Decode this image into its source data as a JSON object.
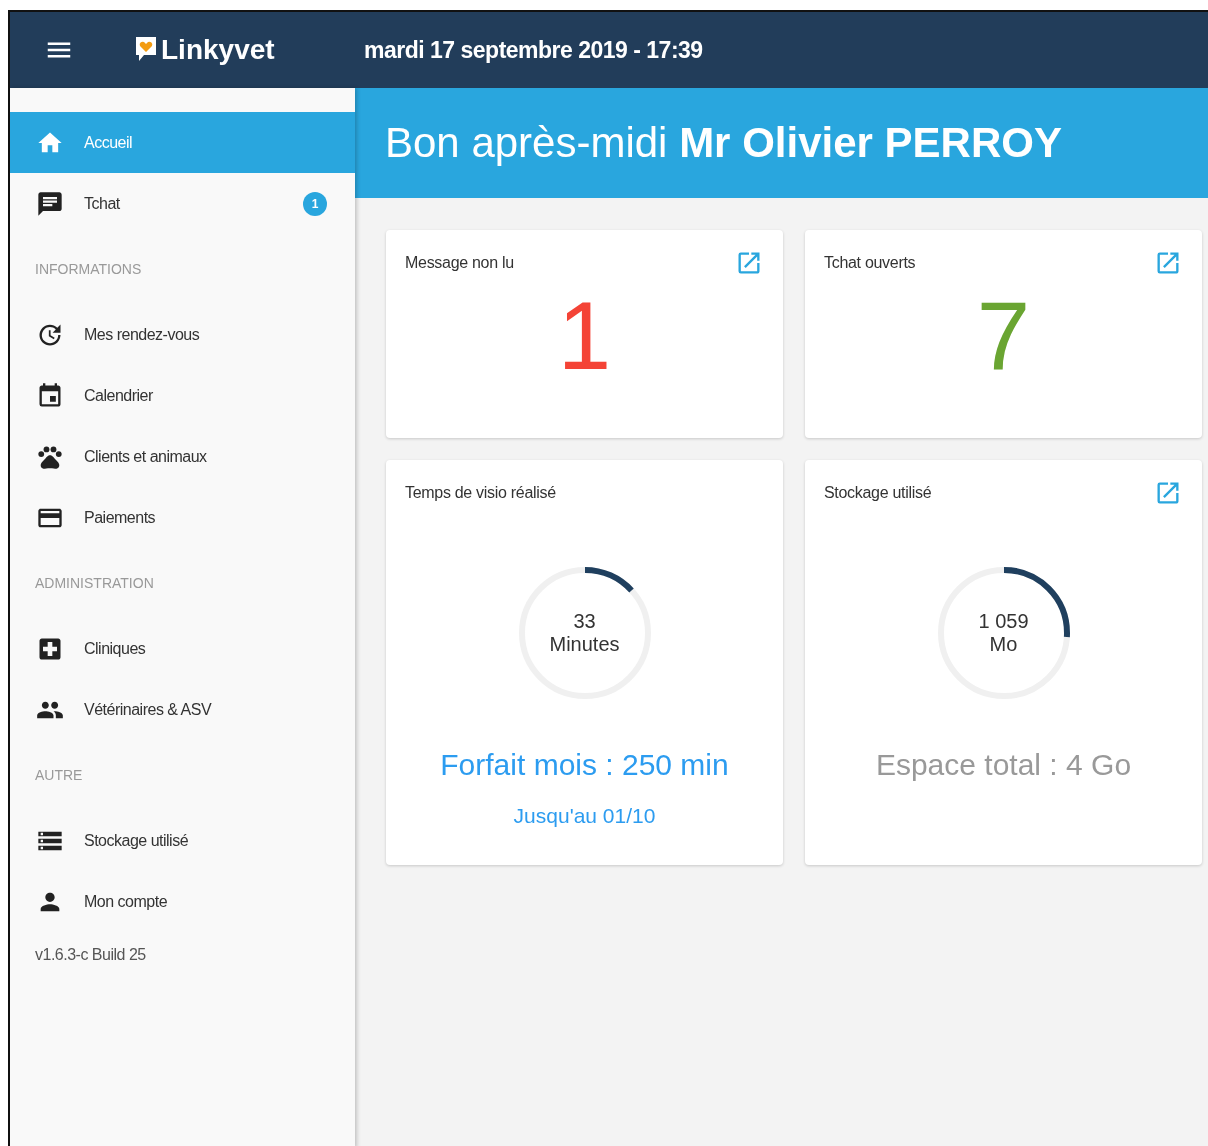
{
  "header": {
    "logo": "Linkyvet",
    "datetime": "mardi 17 septembre 2019 - 17:39"
  },
  "sidebar": {
    "top_items": [
      {
        "label": "Accueil",
        "selected": true
      },
      {
        "label": "Tchat",
        "selected": false,
        "badge": "1"
      }
    ],
    "sections": [
      {
        "title": "INFORMATIONS",
        "items": [
          {
            "label": "Mes rendez-vous",
            "selected": false
          },
          {
            "label": "Calendrier",
            "selected": false
          },
          {
            "label": "Clients et animaux",
            "selected": false
          },
          {
            "label": "Paiements",
            "selected": false
          }
        ]
      },
      {
        "title": "ADMINISTRATION",
        "items": [
          {
            "label": "Cliniques",
            "selected": false
          },
          {
            "label": "Vétérinaires & ASV",
            "selected": false
          }
        ]
      },
      {
        "title": "AUTRE",
        "items": [
          {
            "label": "Stockage utilisé",
            "selected": false
          },
          {
            "label": "Mon compte",
            "selected": false
          }
        ]
      }
    ],
    "version": "v1.6.3-c Build 25"
  },
  "banner": {
    "greeting": "Bon après-midi **Mr Olivier PERROY**"
  },
  "cards": [
    {
      "kind": "number",
      "title": "Message non lu",
      "value": "1",
      "color": "#f44336",
      "link": true
    },
    {
      "kind": "number",
      "title": "Tchat ouverts",
      "value": "7",
      "color": "#6aa532",
      "link": true
    },
    {
      "kind": "gauge",
      "title": "Temps de visio réalisé",
      "value": "33",
      "unit": "Minutes",
      "level": 0.132,
      "link": false,
      "footer": "Forfait mois : 250 min",
      "note": "Jusqu'au 01/10",
      "accent": true
    },
    {
      "kind": "gauge",
      "title": "Stockage utilisé",
      "value": "1 059",
      "unit": "Mo",
      "level": 0.26,
      "link": true,
      "footer": "Espace total : 4 Go",
      "accent": false
    }
  ]
}
